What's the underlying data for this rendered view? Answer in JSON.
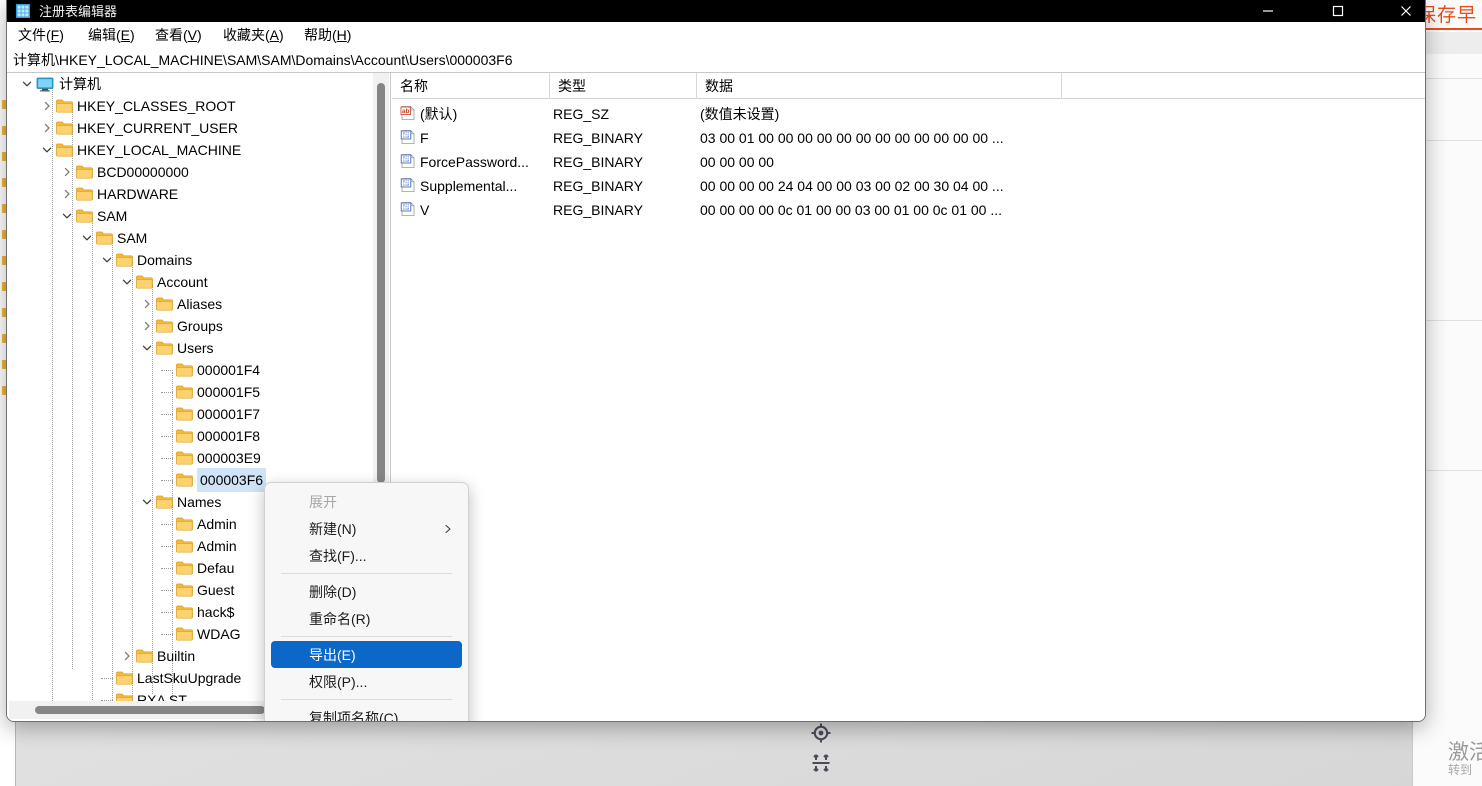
{
  "window": {
    "title": "注册表编辑器",
    "icon": "registry-editor-icon",
    "controls": {
      "minimize": "−",
      "maximize": "□",
      "close": "✕"
    }
  },
  "menubar": {
    "items": [
      {
        "name": "file",
        "pre": "文件(",
        "key": "F",
        "post": ")"
      },
      {
        "name": "edit",
        "pre": "编辑(",
        "key": "E",
        "post": ")"
      },
      {
        "name": "view",
        "pre": "查看(",
        "key": "V",
        "post": ")"
      },
      {
        "name": "favorites",
        "pre": "收藏夹(",
        "key": "A",
        "post": ")"
      },
      {
        "name": "help",
        "pre": "帮助(",
        "key": "H",
        "post": ")"
      }
    ]
  },
  "address": {
    "path": "计算机\\HKEY_LOCAL_MACHINE\\SAM\\SAM\\Domains\\Account\\Users\\000003F6"
  },
  "tree": {
    "items": [
      {
        "label": "计算机",
        "depth": 0,
        "icon": "computer",
        "expander": "expanded",
        "selected": false
      },
      {
        "label": "HKEY_CLASSES_ROOT",
        "depth": 1,
        "icon": "folder",
        "expander": "collapsed",
        "selected": false
      },
      {
        "label": "HKEY_CURRENT_USER",
        "depth": 1,
        "icon": "folder",
        "expander": "collapsed",
        "selected": false
      },
      {
        "label": "HKEY_LOCAL_MACHINE",
        "depth": 1,
        "icon": "folder",
        "expander": "expanded",
        "selected": false
      },
      {
        "label": "BCD00000000",
        "depth": 2,
        "icon": "folder",
        "expander": "collapsed",
        "selected": false
      },
      {
        "label": "HARDWARE",
        "depth": 2,
        "icon": "folder",
        "expander": "collapsed",
        "selected": false
      },
      {
        "label": "SAM",
        "depth": 2,
        "icon": "folder",
        "expander": "expanded",
        "selected": false
      },
      {
        "label": "SAM",
        "depth": 3,
        "icon": "folder",
        "expander": "expanded",
        "selected": false
      },
      {
        "label": "Domains",
        "depth": 4,
        "icon": "folder",
        "expander": "expanded",
        "selected": false
      },
      {
        "label": "Account",
        "depth": 5,
        "icon": "folder",
        "expander": "expanded",
        "selected": false
      },
      {
        "label": "Aliases",
        "depth": 6,
        "icon": "folder",
        "expander": "collapsed",
        "selected": false
      },
      {
        "label": "Groups",
        "depth": 6,
        "icon": "folder",
        "expander": "collapsed",
        "selected": false
      },
      {
        "label": "Users",
        "depth": 6,
        "icon": "folder",
        "expander": "expanded",
        "selected": false
      },
      {
        "label": "000001F4",
        "depth": 7,
        "icon": "folder",
        "expander": "none",
        "selected": false
      },
      {
        "label": "000001F5",
        "depth": 7,
        "icon": "folder",
        "expander": "none",
        "selected": false
      },
      {
        "label": "000001F7",
        "depth": 7,
        "icon": "folder",
        "expander": "none",
        "selected": false
      },
      {
        "label": "000001F8",
        "depth": 7,
        "icon": "folder",
        "expander": "none",
        "selected": false
      },
      {
        "label": "000003E9",
        "depth": 7,
        "icon": "folder",
        "expander": "none",
        "selected": false
      },
      {
        "label": "000003F6",
        "depth": 7,
        "icon": "folder",
        "expander": "none",
        "selected": true
      },
      {
        "label": "Names",
        "depth": 6,
        "icon": "folder",
        "expander": "expanded",
        "selected": false
      },
      {
        "label": "Admin",
        "depth": 7,
        "icon": "folder",
        "expander": "none",
        "selected": false
      },
      {
        "label": "Admin",
        "depth": 7,
        "icon": "folder",
        "expander": "none",
        "selected": false
      },
      {
        "label": "Defau",
        "depth": 7,
        "icon": "folder",
        "expander": "none",
        "selected": false
      },
      {
        "label": "Guest",
        "depth": 7,
        "icon": "folder",
        "expander": "none",
        "selected": false
      },
      {
        "label": "hack$",
        "depth": 7,
        "icon": "folder",
        "expander": "none",
        "selected": false
      },
      {
        "label": "WDAG",
        "depth": 7,
        "icon": "folder",
        "expander": "none",
        "selected": false
      },
      {
        "label": "Builtin",
        "depth": 5,
        "icon": "folder",
        "expander": "collapsed",
        "selected": false
      },
      {
        "label": "LastSkuUpgrade",
        "depth": 4,
        "icon": "folder",
        "expander": "none",
        "selected": false
      },
      {
        "label": "RXA ST",
        "depth": 4,
        "icon": "folder",
        "expander": "none",
        "selected": false
      }
    ]
  },
  "list": {
    "columns": [
      "名称",
      "类型",
      "数据"
    ],
    "rows": [
      {
        "icon": "string-value-icon",
        "name": "(默认)",
        "type": "REG_SZ",
        "data": "(数值未设置)"
      },
      {
        "icon": "binary-value-icon",
        "name": "F",
        "type": "REG_BINARY",
        "data": "03 00 01 00 00 00 00 00 00 00 00 00 00 00 00 ..."
      },
      {
        "icon": "binary-value-icon",
        "name": "ForcePassword...",
        "type": "REG_BINARY",
        "data": "00 00 00 00"
      },
      {
        "icon": "binary-value-icon",
        "name": "Supplemental...",
        "type": "REG_BINARY",
        "data": "00 00 00 00 24 04 00 00 03 00 02 00 30 04 00 ..."
      },
      {
        "icon": "binary-value-icon",
        "name": "V",
        "type": "REG_BINARY",
        "data": "00 00 00 00 0c 01 00 00 03 00 01 00 0c 01 00 ..."
      }
    ]
  },
  "context_menu": {
    "items": [
      {
        "type": "item",
        "label": "展开",
        "state": "disabled",
        "submenu": false
      },
      {
        "type": "item",
        "label": "新建(N)",
        "state": "normal",
        "submenu": true
      },
      {
        "type": "item",
        "label": "查找(F)...",
        "state": "normal",
        "submenu": false
      },
      {
        "type": "separator"
      },
      {
        "type": "item",
        "label": "删除(D)",
        "state": "normal",
        "submenu": false
      },
      {
        "type": "item",
        "label": "重命名(R)",
        "state": "normal",
        "submenu": false
      },
      {
        "type": "separator"
      },
      {
        "type": "item",
        "label": "导出(E)",
        "state": "highlight",
        "submenu": false
      },
      {
        "type": "item",
        "label": "权限(P)...",
        "state": "normal",
        "submenu": false
      },
      {
        "type": "separator"
      },
      {
        "type": "item",
        "label": "复制项名称(C)",
        "state": "normal",
        "submenu": false
      }
    ],
    "highlight_color": "#0b67c8"
  },
  "background": {
    "right_window_title": "保存早",
    "right_window_accent": "#ea4c19"
  },
  "watermark": {
    "line1": "激活",
    "line2": "转到"
  },
  "float_tools": [
    {
      "name": "crosshair-target-icon"
    },
    {
      "name": "distribute-vertical-icon"
    }
  ]
}
